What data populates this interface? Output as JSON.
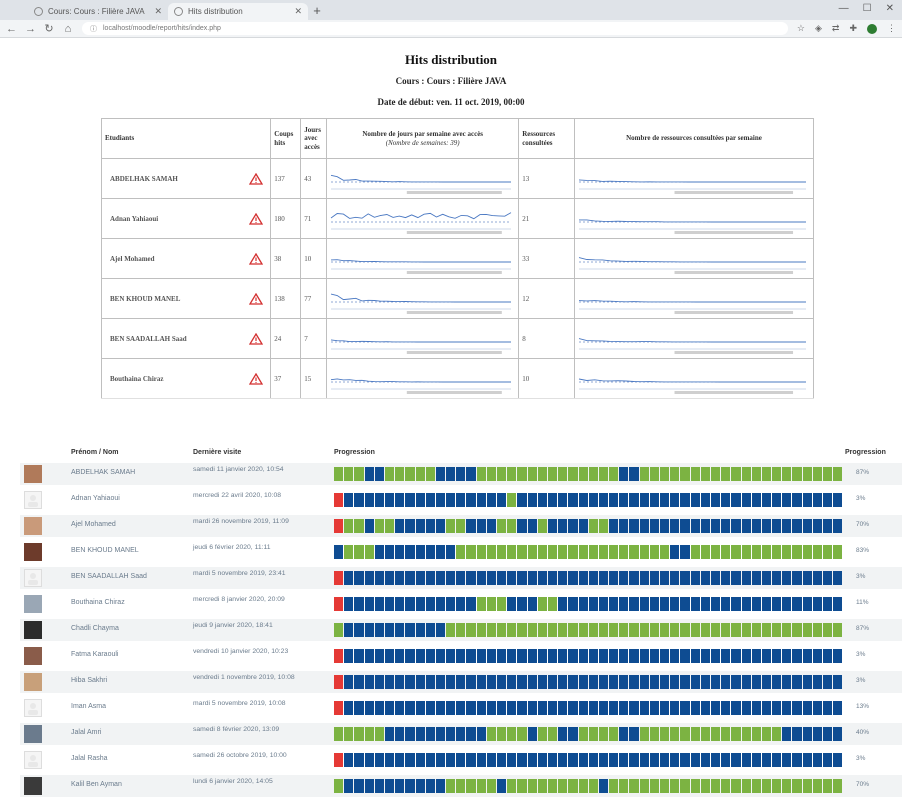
{
  "browser": {
    "tabs": [
      {
        "label": "Cours: Cours : Filière JAVA"
      },
      {
        "label": "Hits distribution"
      }
    ],
    "url": "localhost/moodle/report/hits/index.php",
    "colors": {
      "tabbar": "#dfe3e8",
      "toolbar": "#f2f4f6"
    }
  },
  "report": {
    "title": "Hits distribution",
    "subtitle": "Cours : Cours : Filière JAVA",
    "start_date": "Date de début: ven. 11 oct. 2019, 00:00",
    "columns": {
      "student": "Etudiants",
      "hits": "Coups hits",
      "days": "Jours avec accès",
      "days_per_week": "Nombre de jours par semaine avec accès",
      "days_per_week_sub": "(Nombre de semaines: 39)",
      "resources": "Ressources consultées",
      "resources_per_week": "Nombre de ressources consultées par semaine"
    },
    "rows": [
      {
        "name": "ABDELHAK SAMAH",
        "hits": "137",
        "days": "43",
        "resources": "13",
        "warning_icon": "warning-triangle-icon"
      },
      {
        "name": "Adnan Yahiaoui",
        "hits": "180",
        "days": "71",
        "resources": "21",
        "warning_icon": "warning-triangle-icon"
      },
      {
        "name": "Ajel Mohamed",
        "hits": "38",
        "days": "10",
        "resources": "33",
        "warning_icon": "warning-triangle-icon"
      },
      {
        "name": "BEN KHOUD MANEL",
        "hits": "138",
        "days": "77",
        "resources": "12",
        "warning_icon": "warning-triangle-icon"
      },
      {
        "name": "BEN SAADALLAH Saad",
        "hits": "24",
        "days": "7",
        "resources": "8",
        "warning_icon": "warning-triangle-icon"
      },
      {
        "name": "Bouthaina Chiraz",
        "hits": "37",
        "days": "15",
        "resources": "10",
        "warning_icon": "warning-triangle-icon"
      }
    ]
  },
  "progress_table": {
    "headers": {
      "name": "Prénom / Nom",
      "last_visit": "Dernière visite",
      "progress": "Progression",
      "percent": "Progression"
    },
    "colors": {
      "blue": "#0e4c92",
      "green": "#7cb342",
      "red": "#e53935"
    },
    "rows": [
      {
        "name": "ABDELHAK SAMAH",
        "last_visit": "samedi 11 janvier 2020, 10:54",
        "percent": "87%",
        "avatar": "photo"
      },
      {
        "name": "Adnan Yahiaoui",
        "last_visit": "mercredi 22 avril 2020, 10:08",
        "percent": "3%",
        "avatar": "default"
      },
      {
        "name": "Ajel Mohamed",
        "last_visit": "mardi 26 novembre 2019, 11:09",
        "percent": "70%",
        "avatar": "photo"
      },
      {
        "name": "BEN KHOUD MANEL",
        "last_visit": "jeudi 6 février 2020, 11:11",
        "percent": "83%",
        "avatar": "photo"
      },
      {
        "name": "BEN SAADALLAH Saad",
        "last_visit": "mardi 5 novembre 2019, 23:41",
        "percent": "3%",
        "avatar": "default"
      },
      {
        "name": "Bouthaina Chiraz",
        "last_visit": "mercredi 8 janvier 2020, 20:09",
        "percent": "11%",
        "avatar": "photo"
      },
      {
        "name": "Chadli Chayma",
        "last_visit": "jeudi 9 janvier 2020, 18:41",
        "percent": "87%",
        "avatar": "photo"
      },
      {
        "name": "Fatma Karaouli",
        "last_visit": "vendredi 10 janvier 2020, 10:23",
        "percent": "3%",
        "avatar": "photo"
      },
      {
        "name": "Hiba Sakhri",
        "last_visit": "vendredi 1 novembre 2019, 10:08",
        "percent": "3%",
        "avatar": "photo"
      },
      {
        "name": "Iman Asma",
        "last_visit": "mardi 5 novembre 2019, 10:08",
        "percent": "13%",
        "avatar": "default"
      },
      {
        "name": "Jalal Amri",
        "last_visit": "samedi 8 février 2020, 13:09",
        "percent": "40%",
        "avatar": "photo"
      },
      {
        "name": "Jalal Rasha",
        "last_visit": "samedi 26 octobre 2019, 10:00",
        "percent": "3%",
        "avatar": "default"
      },
      {
        "name": "Kalil Ben Ayman",
        "last_visit": "lundi 6 janvier 2020, 14:05",
        "percent": "70%",
        "avatar": "photo"
      }
    ]
  }
}
